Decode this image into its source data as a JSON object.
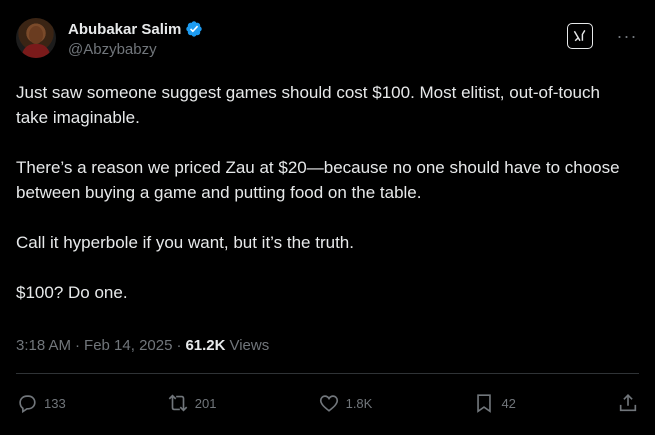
{
  "author": {
    "name": "Abubakar Salim",
    "handle": "@Abzybabzy"
  },
  "tweet": {
    "paragraphs": [
      "Just saw someone suggest games should cost $100. Most elitist, out-of-touch take imaginable.",
      "There’s a reason we priced Zau at $20—because no one should have to choose between buying a game and putting food on the table.",
      "Call it hyperbole if you want, but it’s the truth.",
      "$100? Do one."
    ]
  },
  "meta": {
    "time": "3:18 AM",
    "separator": "·",
    "date": "Feb 14, 2025",
    "views_count": "61.2K",
    "views_label": "Views"
  },
  "actions": {
    "replies": "133",
    "reposts": "201",
    "likes": "1.8K",
    "bookmarks": "42"
  },
  "colors": {
    "background": "#000000",
    "text": "#e7e9ea",
    "muted": "#71767b",
    "verified": "#1d9bf0",
    "divider": "#2f3336"
  },
  "icons": [
    "verified-badge-icon",
    "grok-icon",
    "more-icon",
    "reply-icon",
    "repost-icon",
    "like-icon",
    "bookmark-icon",
    "share-icon"
  ]
}
